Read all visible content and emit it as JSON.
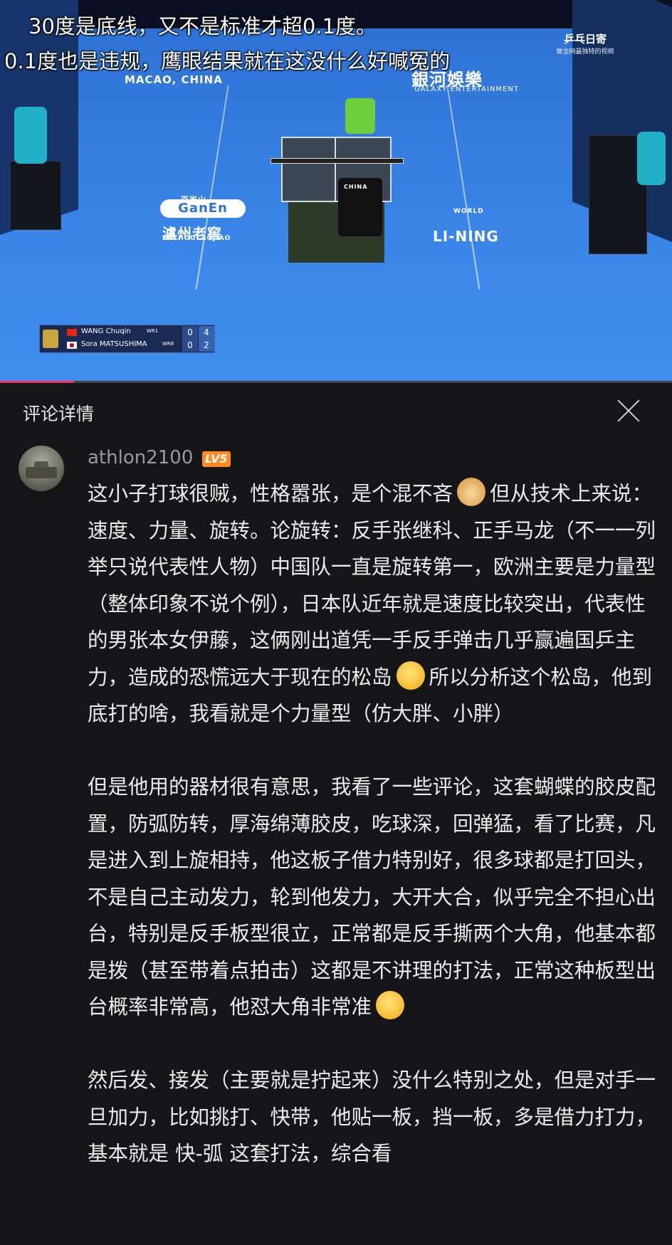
{
  "video": {
    "caption_line1": "30度是底线，又不是标准才超0.1度。",
    "caption_line2": "0.1度也是违规，鹰眼结果就在这没什么好喊冤的",
    "venue_text": "MACAO, CHINA",
    "sponsor_galaxy_cn": "銀河娛樂",
    "sponsor_galaxy_en": "GALAXY ENTERTAINMENT",
    "sponsor_ganen": "GanEn",
    "sponsor_ganen_cn": "百岁山",
    "sponsor_luzhou_cn": "瀘州老窖",
    "sponsor_luzhou_en": "LUZHOULAOJIAO",
    "sponsor_lining": "LI-NING",
    "sponsor_wtt_world": "WORLD",
    "watermark_title": "乒乓日寄",
    "watermark_sub": "做全网最独特的视频",
    "player_shirt": "CHINA",
    "scoreboard": {
      "player1": {
        "name": "WANG Chuqin",
        "rank": "WR1",
        "games": "0",
        "points": "4",
        "flag_color": "#de2910"
      },
      "player2": {
        "name": "Sora MATSUSHIMA",
        "rank": "WR8",
        "games": "0",
        "points": "2",
        "flag_color": "#ffffff"
      }
    },
    "progress": 0.11
  },
  "panel": {
    "title": "评论详情",
    "close_icon": "close-icon"
  },
  "comment": {
    "username": "athlon2100",
    "level": "LV5",
    "para1_a": "这小子打球很贼，性格嚣张，是个混不吝",
    "para1_b": "但从技术上来说：速度、力量、旋转。论旋转：反手张继科、正手马龙（不一一列举只说代表性人物）中国队一直是旋转第一，欧洲主要是力量型（整体印象不说个例），日本队近年就是速度比较突出，代表性的男张本女伊藤，这俩刚出道凭一手反手弹击几乎赢遍国乒主力，造成的恐慌远大于现在的松岛",
    "para1_c": "所以分析这个松岛，他到底打的啥，我看就是个力量型（仿大胖、小胖）",
    "para2": "但是他用的器材很有意思，我看了一些评论，这套蝴蝶的胶皮配置，防弧防转，厚海绵薄胶皮，吃球深，回弹猛，看了比赛，凡是进入到上旋相持，他这板子借力特别好，很多球都是打回头，不是自己主动发力，轮到他发力，大开大合，似乎完全不担心出台，特别是反手板型很立，正常都是反手撕两个大角，他基本都是拨（甚至带着点拍击）这都是不讲理的打法，正常这种板型出台概率非常高，他怼大角非常准",
    "para3": "然后发、接发（主要就是拧起来）没什么特别之处，但是对手一旦加力，比如挑打、快带，他贴一板，挡一板，多是借力打力，基本就是 快-弧 这套打法，综合看"
  }
}
